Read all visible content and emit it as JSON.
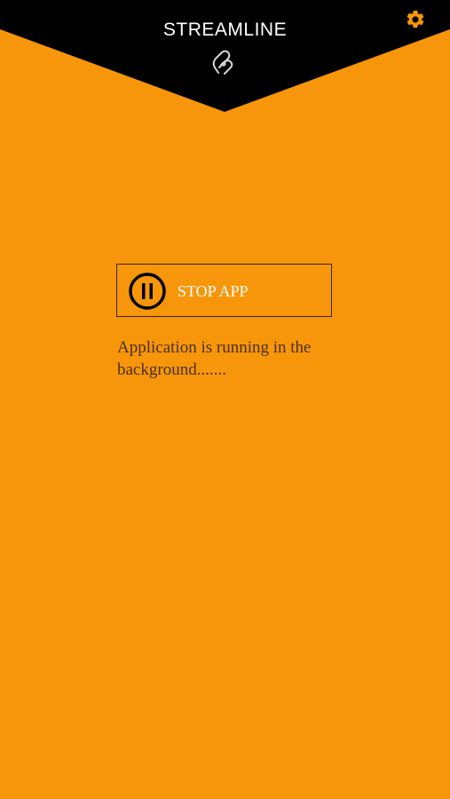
{
  "header": {
    "title": "STREAMLINE",
    "logo_icon": "streamline-logo-icon",
    "settings_icon": "gear-icon",
    "background_color": "#000000",
    "accent_color": "#f7960a"
  },
  "main": {
    "stop_button": {
      "label": "STOP APP",
      "icon": "pause-icon"
    },
    "status_message": "Application is running in the background......."
  },
  "colors": {
    "background": "#f7960a",
    "dark": "#000000",
    "text": "#4a3018"
  }
}
